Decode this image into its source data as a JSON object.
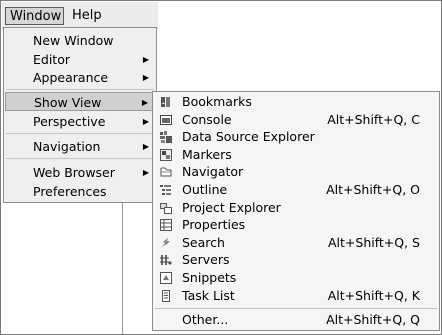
{
  "menubar": {
    "window": "Window",
    "help": "Help"
  },
  "window_menu": {
    "new_window": "New Window",
    "editor": "Editor",
    "appearance": "Appearance",
    "show_view": "Show View",
    "perspective": "Perspective",
    "navigation": "Navigation",
    "web_browser": "Web Browser",
    "preferences": "Preferences",
    "arrow": "▶"
  },
  "show_view_menu": {
    "items": [
      {
        "label": "Bookmarks",
        "shortcut": "",
        "icon": "bookmarks-icon"
      },
      {
        "label": "Console",
        "shortcut": "Alt+Shift+Q, C",
        "icon": "console-icon"
      },
      {
        "label": "Data Source Explorer",
        "shortcut": "",
        "icon": "data-source-icon"
      },
      {
        "label": "Markers",
        "shortcut": "",
        "icon": "markers-icon"
      },
      {
        "label": "Navigator",
        "shortcut": "",
        "icon": "navigator-icon"
      },
      {
        "label": "Outline",
        "shortcut": "Alt+Shift+Q, O",
        "icon": "outline-icon"
      },
      {
        "label": "Project Explorer",
        "shortcut": "",
        "icon": "project-explorer-icon"
      },
      {
        "label": "Properties",
        "shortcut": "",
        "icon": "properties-icon"
      },
      {
        "label": "Search",
        "shortcut": "Alt+Shift+Q, S",
        "icon": "search-icon"
      },
      {
        "label": "Servers",
        "shortcut": "",
        "icon": "servers-icon"
      },
      {
        "label": "Snippets",
        "shortcut": "",
        "icon": "snippets-icon"
      },
      {
        "label": "Task List",
        "shortcut": "Alt+Shift+Q, K",
        "icon": "task-list-icon"
      }
    ],
    "other": {
      "label": "Other...",
      "shortcut": "Alt+Shift+Q, Q"
    }
  }
}
